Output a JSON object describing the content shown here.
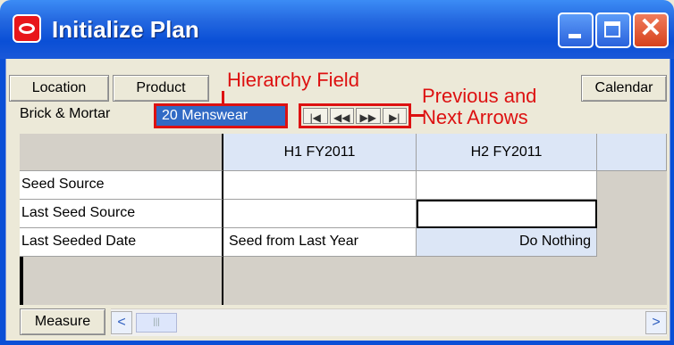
{
  "window": {
    "title": "Initialize Plan",
    "close_glyph": "✕"
  },
  "toolbar": {
    "location_label": "Location",
    "product_label": "Product",
    "calendar_label": "Calendar",
    "measure_label": "Measure"
  },
  "hierarchy": {
    "location_value": "Brick & Mortar",
    "product_value": "20 Menswear"
  },
  "nav_arrows": [
    "|◀",
    "◀◀",
    "▶▶",
    "▶|"
  ],
  "annotations": {
    "hierarchy_field": "Hierarchy Field",
    "arrows_line1": "Previous and",
    "arrows_line2": "Next Arrows"
  },
  "grid": {
    "columns": [
      "H1 FY2011",
      "H2 FY2011"
    ],
    "rows": [
      {
        "label": "Seed Source",
        "values": [
          "",
          ""
        ]
      },
      {
        "label": "Last Seed Source",
        "values": [
          "",
          ""
        ]
      },
      {
        "label": "Last Seeded Date",
        "values": [
          "Seed from Last Year",
          "Do Nothing"
        ]
      }
    ]
  },
  "scrollbar": {
    "left_glyph": "<",
    "thumb_glyph": "|||",
    "right_glyph": ">"
  },
  "colors": {
    "annotation_red": "#dd1111",
    "selection_blue": "#316ac5",
    "header_blue": "#dce6f6"
  }
}
